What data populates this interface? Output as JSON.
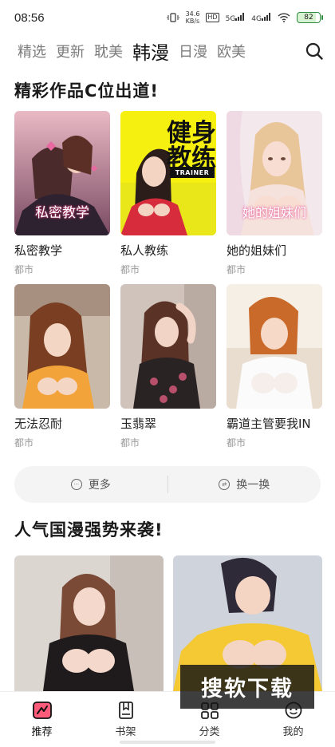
{
  "status_bar": {
    "time": "08:56",
    "net_speed_value": "34.6",
    "net_speed_unit": "KB/s",
    "hd": "HD",
    "signal_1": "5G",
    "signal_2": "4G",
    "battery": "82"
  },
  "tabs": [
    {
      "label": "精选",
      "active": false
    },
    {
      "label": "更新",
      "active": false
    },
    {
      "label": "耽美",
      "active": false
    },
    {
      "label": "韩漫",
      "active": true
    },
    {
      "label": "日漫",
      "active": false
    },
    {
      "label": "欧美",
      "active": false
    }
  ],
  "section1": {
    "title": "精彩作品C位出道!",
    "items": [
      {
        "title": "私密教学",
        "tag": "都市",
        "cover_text": "私密教学"
      },
      {
        "title": "私人教练",
        "tag": "都市",
        "cover_text_1": "健身",
        "cover_text_2": "教练",
        "cover_banner": "TRAINER"
      },
      {
        "title": "她的姐妹们",
        "tag": "都市",
        "cover_text": "她的姐妹们"
      },
      {
        "title": "无法忍耐",
        "tag": "都市"
      },
      {
        "title": "玉翡翠",
        "tag": "都市"
      },
      {
        "title": "霸道主管要我IN",
        "tag": "都市"
      }
    ]
  },
  "actions": {
    "more": "更多",
    "refresh": "换一换"
  },
  "section2": {
    "title": "人气国漫强势来袭!"
  },
  "watermark": "搜软下载",
  "bottom_nav": [
    {
      "label": "推荐",
      "icon": "recommend-icon",
      "active": true
    },
    {
      "label": "书架",
      "icon": "bookshelf-icon",
      "active": false
    },
    {
      "label": "分类",
      "icon": "category-icon",
      "active": false
    },
    {
      "label": "我的",
      "icon": "profile-icon",
      "active": false
    }
  ],
  "colors": {
    "accent_active_tab": "#111111",
    "inactive_tab": "#7c7c7c",
    "tag_gray": "#9a9a9a",
    "action_bar_bg": "#f4f4f4",
    "battery_green": "#2b8a3e"
  }
}
